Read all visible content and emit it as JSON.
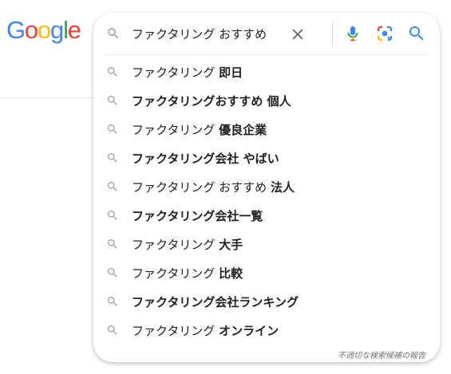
{
  "logo": {
    "letters": [
      "G",
      "o",
      "o",
      "g",
      "l",
      "e"
    ],
    "colors": [
      "#4285F4",
      "#EA4335",
      "#FBBC05",
      "#4285F4",
      "#34A853",
      "#EA4335"
    ]
  },
  "search": {
    "query": "ファクタリング おすすめ"
  },
  "icons": {
    "search": "search-icon",
    "clear": "close-icon",
    "mic": "microphone-icon",
    "lens": "camera-lens-icon"
  },
  "suggestions": [
    {
      "prefix": "ファクタリング ",
      "bold": "即日"
    },
    {
      "prefix": "",
      "bold": "ファクタリングおすすめ 個人"
    },
    {
      "prefix": "ファクタリング ",
      "bold": "優良企業"
    },
    {
      "prefix": "",
      "bold": "ファクタリング会社 やばい"
    },
    {
      "prefix": "ファクタリング おすすめ ",
      "bold": "法人"
    },
    {
      "prefix": "",
      "bold": "ファクタリング会社一覧"
    },
    {
      "prefix": "ファクタリング ",
      "bold": "大手"
    },
    {
      "prefix": "ファクタリング ",
      "bold": "比較"
    },
    {
      "prefix": "",
      "bold": "ファクタリング会社ランキング"
    },
    {
      "prefix": "ファクタリング ",
      "bold": "オンライン"
    }
  ],
  "report_link": "不適切な検索候補の報告"
}
